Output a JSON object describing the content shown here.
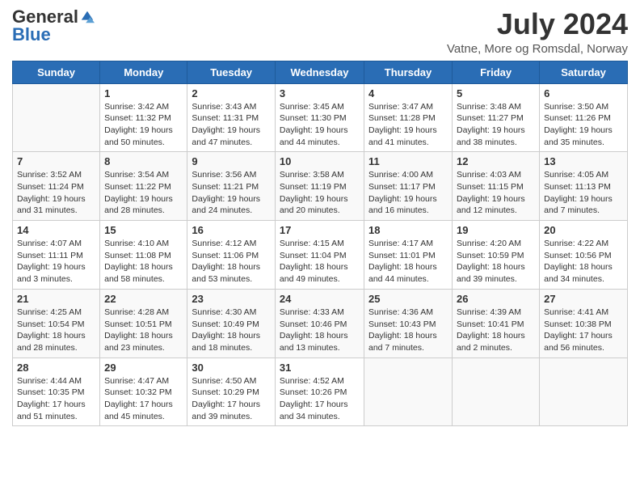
{
  "header": {
    "logo_general": "General",
    "logo_blue": "Blue",
    "month_title": "July 2024",
    "location": "Vatne, More og Romsdal, Norway"
  },
  "days_of_week": [
    "Sunday",
    "Monday",
    "Tuesday",
    "Wednesday",
    "Thursday",
    "Friday",
    "Saturday"
  ],
  "weeks": [
    [
      {
        "day": null
      },
      {
        "day": "1",
        "sunrise": "3:42 AM",
        "sunset": "11:32 PM",
        "daylight": "19 hours and 50 minutes."
      },
      {
        "day": "2",
        "sunrise": "3:43 AM",
        "sunset": "11:31 PM",
        "daylight": "19 hours and 47 minutes."
      },
      {
        "day": "3",
        "sunrise": "3:45 AM",
        "sunset": "11:30 PM",
        "daylight": "19 hours and 44 minutes."
      },
      {
        "day": "4",
        "sunrise": "3:47 AM",
        "sunset": "11:28 PM",
        "daylight": "19 hours and 41 minutes."
      },
      {
        "day": "5",
        "sunrise": "3:48 AM",
        "sunset": "11:27 PM",
        "daylight": "19 hours and 38 minutes."
      },
      {
        "day": "6",
        "sunrise": "3:50 AM",
        "sunset": "11:26 PM",
        "daylight": "19 hours and 35 minutes."
      }
    ],
    [
      {
        "day": "7",
        "sunrise": "3:52 AM",
        "sunset": "11:24 PM",
        "daylight": "19 hours and 31 minutes."
      },
      {
        "day": "8",
        "sunrise": "3:54 AM",
        "sunset": "11:22 PM",
        "daylight": "19 hours and 28 minutes."
      },
      {
        "day": "9",
        "sunrise": "3:56 AM",
        "sunset": "11:21 PM",
        "daylight": "19 hours and 24 minutes."
      },
      {
        "day": "10",
        "sunrise": "3:58 AM",
        "sunset": "11:19 PM",
        "daylight": "19 hours and 20 minutes."
      },
      {
        "day": "11",
        "sunrise": "4:00 AM",
        "sunset": "11:17 PM",
        "daylight": "19 hours and 16 minutes."
      },
      {
        "day": "12",
        "sunrise": "4:03 AM",
        "sunset": "11:15 PM",
        "daylight": "19 hours and 12 minutes."
      },
      {
        "day": "13",
        "sunrise": "4:05 AM",
        "sunset": "11:13 PM",
        "daylight": "19 hours and 7 minutes."
      }
    ],
    [
      {
        "day": "14",
        "sunrise": "4:07 AM",
        "sunset": "11:11 PM",
        "daylight": "19 hours and 3 minutes."
      },
      {
        "day": "15",
        "sunrise": "4:10 AM",
        "sunset": "11:08 PM",
        "daylight": "18 hours and 58 minutes."
      },
      {
        "day": "16",
        "sunrise": "4:12 AM",
        "sunset": "11:06 PM",
        "daylight": "18 hours and 53 minutes."
      },
      {
        "day": "17",
        "sunrise": "4:15 AM",
        "sunset": "11:04 PM",
        "daylight": "18 hours and 49 minutes."
      },
      {
        "day": "18",
        "sunrise": "4:17 AM",
        "sunset": "11:01 PM",
        "daylight": "18 hours and 44 minutes."
      },
      {
        "day": "19",
        "sunrise": "4:20 AM",
        "sunset": "10:59 PM",
        "daylight": "18 hours and 39 minutes."
      },
      {
        "day": "20",
        "sunrise": "4:22 AM",
        "sunset": "10:56 PM",
        "daylight": "18 hours and 34 minutes."
      }
    ],
    [
      {
        "day": "21",
        "sunrise": "4:25 AM",
        "sunset": "10:54 PM",
        "daylight": "18 hours and 28 minutes."
      },
      {
        "day": "22",
        "sunrise": "4:28 AM",
        "sunset": "10:51 PM",
        "daylight": "18 hours and 23 minutes."
      },
      {
        "day": "23",
        "sunrise": "4:30 AM",
        "sunset": "10:49 PM",
        "daylight": "18 hours and 18 minutes."
      },
      {
        "day": "24",
        "sunrise": "4:33 AM",
        "sunset": "10:46 PM",
        "daylight": "18 hours and 13 minutes."
      },
      {
        "day": "25",
        "sunrise": "4:36 AM",
        "sunset": "10:43 PM",
        "daylight": "18 hours and 7 minutes."
      },
      {
        "day": "26",
        "sunrise": "4:39 AM",
        "sunset": "10:41 PM",
        "daylight": "18 hours and 2 minutes."
      },
      {
        "day": "27",
        "sunrise": "4:41 AM",
        "sunset": "10:38 PM",
        "daylight": "17 hours and 56 minutes."
      }
    ],
    [
      {
        "day": "28",
        "sunrise": "4:44 AM",
        "sunset": "10:35 PM",
        "daylight": "17 hours and 51 minutes."
      },
      {
        "day": "29",
        "sunrise": "4:47 AM",
        "sunset": "10:32 PM",
        "daylight": "17 hours and 45 minutes."
      },
      {
        "day": "30",
        "sunrise": "4:50 AM",
        "sunset": "10:29 PM",
        "daylight": "17 hours and 39 minutes."
      },
      {
        "day": "31",
        "sunrise": "4:52 AM",
        "sunset": "10:26 PM",
        "daylight": "17 hours and 34 minutes."
      },
      {
        "day": null
      },
      {
        "day": null
      },
      {
        "day": null
      }
    ]
  ]
}
